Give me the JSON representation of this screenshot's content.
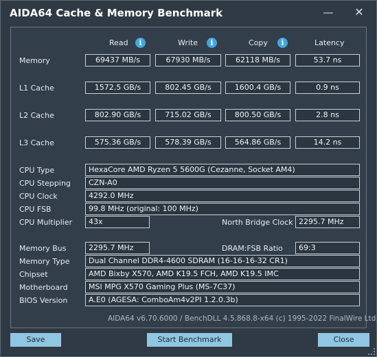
{
  "window": {
    "title": "AIDA64 Cache & Memory Benchmark",
    "minimize_glyph": "—",
    "close_glyph": "✕"
  },
  "columns": {
    "read": "Read",
    "write": "Write",
    "copy": "Copy",
    "latency": "Latency",
    "info_glyph": "i"
  },
  "rows": [
    {
      "label": "Memory",
      "read": "69437 MB/s",
      "write": "67930 MB/s",
      "copy": "62118 MB/s",
      "latency": "53.7 ns"
    },
    {
      "label": "L1 Cache",
      "read": "1572.5 GB/s",
      "write": "802.45 GB/s",
      "copy": "1600.4 GB/s",
      "latency": "0.9 ns"
    },
    {
      "label": "L2 Cache",
      "read": "802.90 GB/s",
      "write": "715.02 GB/s",
      "copy": "800.50 GB/s",
      "latency": "2.8 ns"
    },
    {
      "label": "L3 Cache",
      "read": "575.36 GB/s",
      "write": "578.39 GB/s",
      "copy": "564.86 GB/s",
      "latency": "14.2 ns"
    }
  ],
  "cpu": {
    "type_label": "CPU Type",
    "type": "HexaCore AMD Ryzen 5 5600G  (Cezanne, Socket AM4)",
    "stepping_label": "CPU Stepping",
    "stepping": "CZN-A0",
    "clock_label": "CPU Clock",
    "clock": "4292.0 MHz",
    "fsb_label": "CPU FSB",
    "fsb": "99.8 MHz  (original: 100 MHz)",
    "multiplier_label": "CPU Multiplier",
    "multiplier": "43x",
    "nb_clock_label": "North Bridge Clock",
    "nb_clock": "2295.7 MHz"
  },
  "memory": {
    "bus_label": "Memory Bus",
    "bus": "2295.7 MHz",
    "ratio_label": "DRAM:FSB Ratio",
    "ratio": "69:3",
    "type_label": "Memory Type",
    "type": "Dual Channel DDR4-4600 SDRAM  (16-16-16-32 CR1)",
    "chipset_label": "Chipset",
    "chipset": "AMD Bixby X570, AMD K19.5 FCH, AMD K19.5 IMC",
    "motherboard_label": "Motherboard",
    "motherboard": "MSI MPG X570 Gaming Plus (MS-7C37)",
    "bios_label": "BIOS Version",
    "bios": "A.E0  (AGESA: ComboAm4v2PI 1.2.0.3b)"
  },
  "footer": {
    "note": "AIDA64 v6.70.6000 / BenchDLL 4.5.868.8-x64  (c) 1995-2022 FinalWire Ltd."
  },
  "buttons": {
    "save": "Save",
    "start": "Start Benchmark",
    "close": "Close"
  }
}
